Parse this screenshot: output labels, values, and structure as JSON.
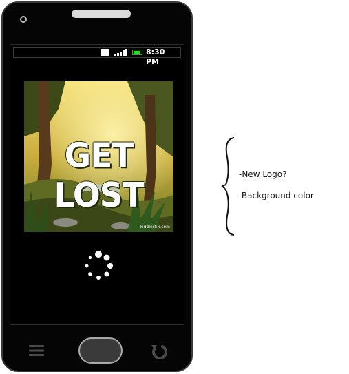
{
  "status_bar": {
    "time": "8:30 PM",
    "icons": [
      "notification-square-icon",
      "signal-icon",
      "battery-icon"
    ],
    "battery_color": "#22dd22"
  },
  "splash": {
    "logo_text": "GET LOST",
    "watermark": "Fiddlestix.com",
    "loading_indicator": "spinner-icon"
  },
  "nav_bar": {
    "buttons": [
      "menu-icon",
      "home-button",
      "back-icon"
    ]
  },
  "annotations": {
    "notes": [
      "-New Logo?",
      "-Background color"
    ]
  },
  "colors": {
    "phone_body": "#050505",
    "home_button": "#3a3a3a",
    "annotation_text": "#1a1a1a"
  }
}
